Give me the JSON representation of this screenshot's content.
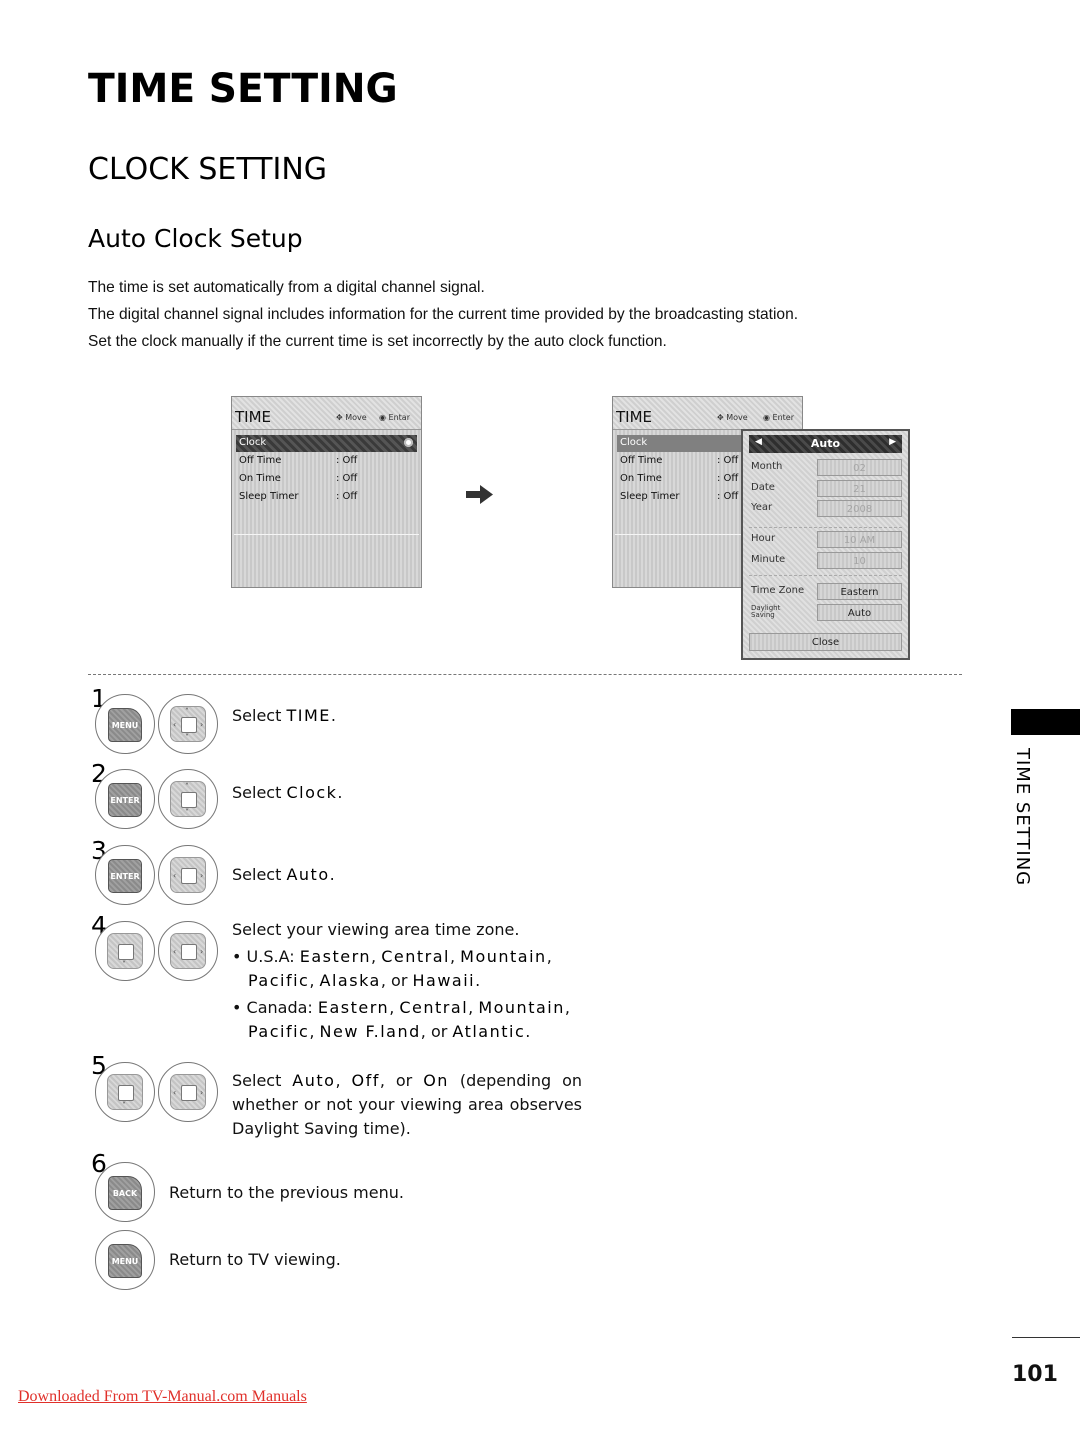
{
  "page": {
    "title": "TIME SETTING",
    "section_title": "CLOCK SETTING",
    "subsection_title": "Auto Clock Setup",
    "paragraphs": [
      "The time is set automatically from a digital channel signal.",
      "The digital channel signal includes information for the current time provided by the broadcasting station.",
      "Set the clock manually if the current time is set incorrectly by the auto clock function."
    ],
    "side_tab_label": "TIME SETTING",
    "page_number": "101",
    "footer_link": "Downloaded From TV-Manual.com Manuals"
  },
  "osd_left": {
    "title": "TIME",
    "hint_move": "Move",
    "hint_enter": "Entar",
    "rows": [
      {
        "label": "Clock",
        "value": ""
      },
      {
        "label": "Off Time",
        "value": ": Off"
      },
      {
        "label": "On Time",
        "value": ": Off"
      },
      {
        "label": "Sleep Timer",
        "value": ": Off"
      }
    ]
  },
  "osd_right": {
    "title": "TIME",
    "hint_move": "Move",
    "hint_enter": "Enter",
    "rows": [
      {
        "label": "Clock",
        "value": ""
      },
      {
        "label": "Off Time",
        "value": ": Off"
      },
      {
        "label": "On Time",
        "value": ": Off"
      },
      {
        "label": "Sleep Timer",
        "value": ": Off"
      }
    ],
    "popup": {
      "mode": "Auto",
      "fields": [
        {
          "label": "Month",
          "value": "02"
        },
        {
          "label": "Date",
          "value": "21"
        },
        {
          "label": "Year",
          "value": "2008"
        },
        {
          "label": "Hour",
          "value": "10 AM"
        },
        {
          "label": "Minute",
          "value": "10"
        },
        {
          "label": "Time Zone",
          "value": "Eastern"
        },
        {
          "label": "Daylight Saving",
          "label_line1": "Daylight",
          "label_line2": "Saving",
          "value": "Auto"
        }
      ],
      "close_label": "Close"
    }
  },
  "steps": [
    {
      "num": "1",
      "keys": [
        "MENU",
        "dpad-4way"
      ],
      "text_pre": "Select ",
      "text_bold": "TIME",
      "text_post": "."
    },
    {
      "num": "2",
      "keys": [
        "ENTER",
        "dpad-updown"
      ],
      "text_pre": "Select ",
      "text_bold": "Clock",
      "text_post": "."
    },
    {
      "num": "3",
      "keys": [
        "ENTER",
        "dpad-leftright"
      ],
      "text_pre": "Select ",
      "text_bold": "Auto",
      "text_post": "."
    },
    {
      "num": "4",
      "keys": [
        "dpad-down",
        "dpad-leftright"
      ],
      "text": "Select your viewing area time zone.",
      "bullets": [
        {
          "prefix": "U.S.A: ",
          "items": [
            "Eastern",
            "Central",
            "Mountain",
            "Pacific",
            "Alaska"
          ],
          "last": "Hawaii"
        },
        {
          "prefix": "Canada: ",
          "items": [
            "Eastern",
            "Central",
            "Mountain",
            "Pacific",
            "New F.land"
          ],
          "last": "Atlantic"
        }
      ]
    },
    {
      "num": "5",
      "keys": [
        "dpad-down",
        "dpad-leftright"
      ],
      "text_pre": "Select ",
      "opt1": "Auto",
      "opt2": "Off",
      "opt3": "On",
      "text_post": " (depending on whether or not your viewing area observes Daylight Saving time)."
    },
    {
      "num": "6",
      "keys": [
        "BACK"
      ],
      "text": "Return to the previous menu."
    },
    {
      "num": "",
      "keys": [
        "MENU"
      ],
      "text": "Return to TV viewing."
    }
  ],
  "labels": {
    "or": "or",
    "comma": ","
  }
}
